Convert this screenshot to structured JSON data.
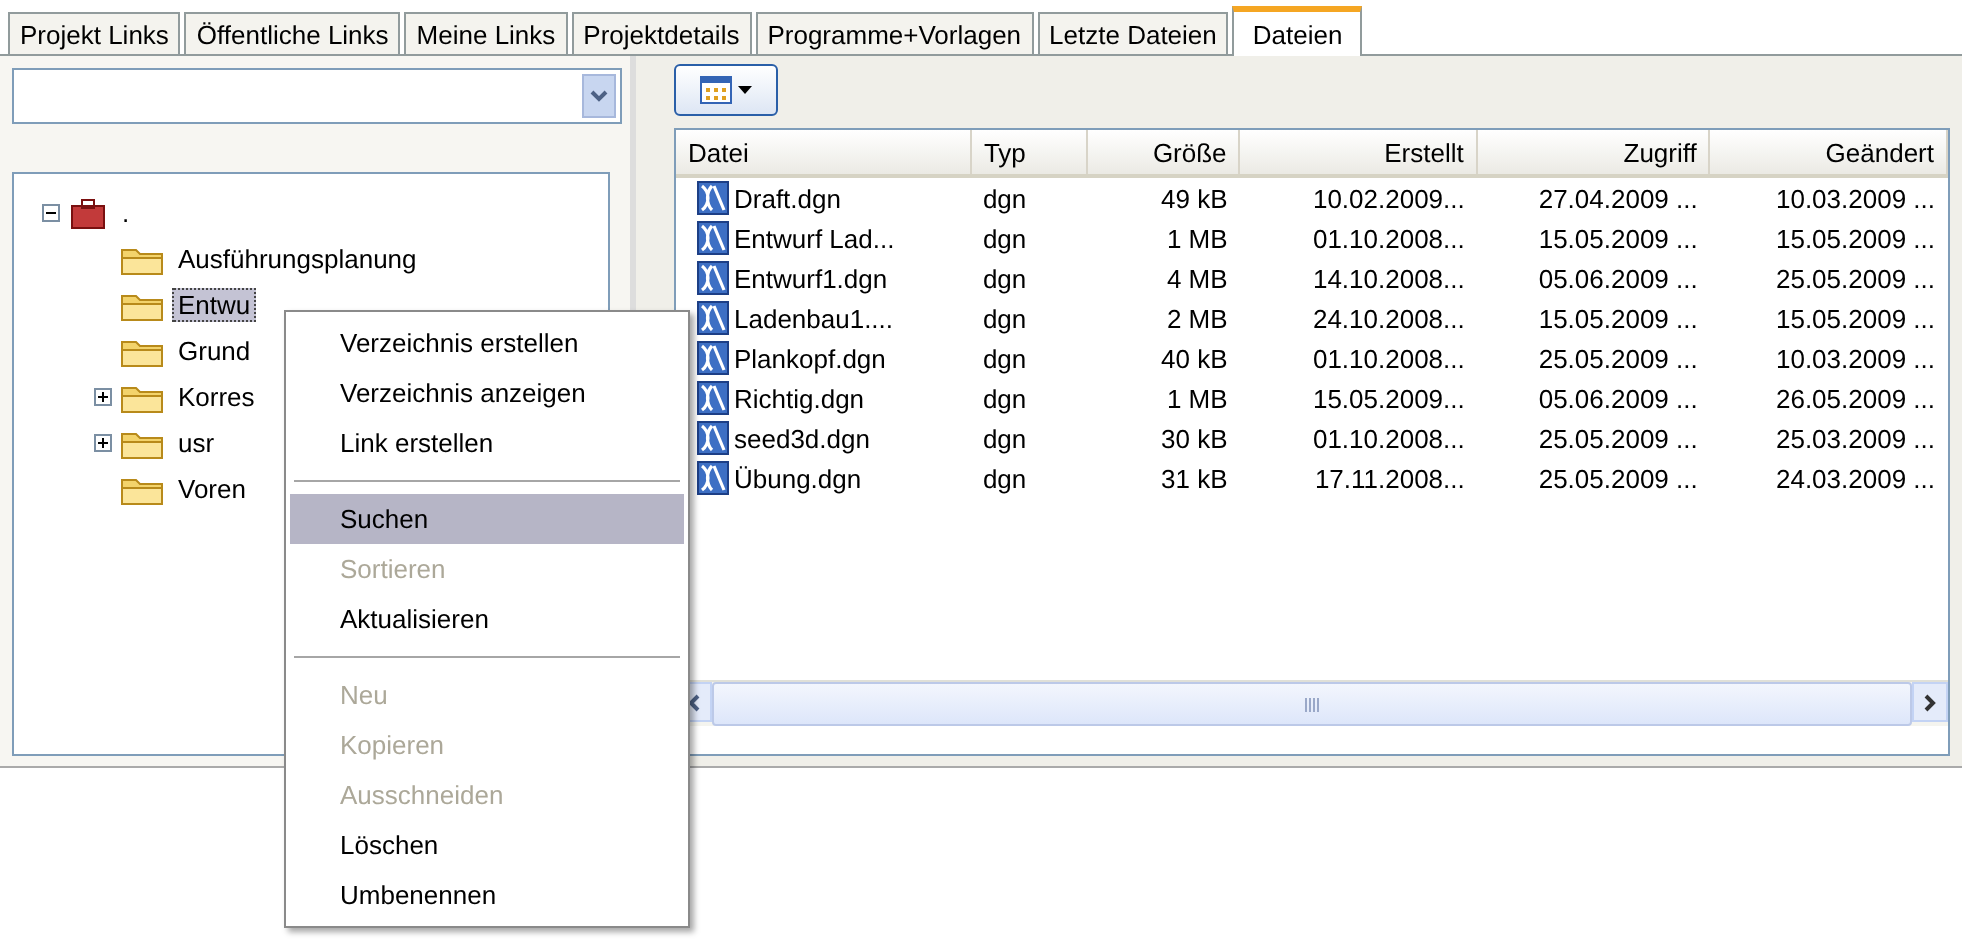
{
  "tabs": [
    {
      "label": "Projekt Links",
      "selected": false
    },
    {
      "label": "Öffentliche Links",
      "selected": false
    },
    {
      "label": "Meine Links",
      "selected": false
    },
    {
      "label": "Projektdetails",
      "selected": false
    },
    {
      "label": "Programme+Vorlagen",
      "selected": false
    },
    {
      "label": "Letzte Dateien",
      "selected": false
    },
    {
      "label": "Dateien",
      "selected": true
    }
  ],
  "tree": {
    "root": {
      "label": ".",
      "expanded": true
    },
    "children": [
      {
        "label": "Ausführungsplanung",
        "kind": "leaf",
        "selected": false
      },
      {
        "label": "Entwu",
        "kind": "leaf",
        "selected": true
      },
      {
        "label": "Grund",
        "kind": "leaf",
        "selected": false
      },
      {
        "label": "Korres",
        "kind": "collapsed",
        "selected": false
      },
      {
        "label": "usr",
        "kind": "collapsed",
        "selected": false
      },
      {
        "label": "Voren",
        "kind": "leaf",
        "selected": false
      }
    ]
  },
  "files": {
    "columns": [
      "Datei",
      "Typ",
      "Größe",
      "Erstellt",
      "Zugriff",
      "Geändert"
    ],
    "rows": [
      [
        "Draft.dgn",
        "dgn",
        "49 kB",
        "10.02.2009...",
        "27.04.2009 ...",
        "10.03.2009 ..."
      ],
      [
        "Entwurf Lad...",
        "dgn",
        "1 MB",
        "01.10.2008...",
        "15.05.2009 ...",
        "15.05.2009 ..."
      ],
      [
        "Entwurf1.dgn",
        "dgn",
        "4 MB",
        "14.10.2008...",
        "05.06.2009 ...",
        "25.05.2009 ..."
      ],
      [
        "Ladenbau1....",
        "dgn",
        "2 MB",
        "24.10.2008...",
        "15.05.2009 ...",
        "15.05.2009 ..."
      ],
      [
        "Plankopf.dgn",
        "dgn",
        "40 kB",
        "01.10.2008...",
        "25.05.2009 ...",
        "10.03.2009 ..."
      ],
      [
        "Richtig.dgn",
        "dgn",
        "1 MB",
        "15.05.2009...",
        "05.06.2009 ...",
        "26.05.2009 ..."
      ],
      [
        "seed3d.dgn",
        "dgn",
        "30 kB",
        "01.10.2008...",
        "25.05.2009 ...",
        "25.03.2009 ..."
      ],
      [
        "Übung.dgn",
        "dgn",
        "31 kB",
        "17.11.2008...",
        "25.05.2009 ...",
        "24.03.2009 ..."
      ]
    ]
  },
  "context_menu": [
    {
      "kind": "item",
      "label": "Verzeichnis erstellen",
      "disabled": false,
      "selected": false
    },
    {
      "kind": "item",
      "label": "Verzeichnis anzeigen",
      "disabled": false,
      "selected": false
    },
    {
      "kind": "item",
      "label": "Link erstellen",
      "disabled": false,
      "selected": false
    },
    {
      "kind": "separator"
    },
    {
      "kind": "item",
      "label": "Suchen",
      "disabled": false,
      "selected": true
    },
    {
      "kind": "item",
      "label": "Sortieren",
      "disabled": true,
      "selected": false
    },
    {
      "kind": "item",
      "label": "Aktualisieren",
      "disabled": false,
      "selected": false
    },
    {
      "kind": "separator"
    },
    {
      "kind": "item",
      "label": "Neu",
      "disabled": true,
      "selected": false
    },
    {
      "kind": "item",
      "label": "Kopieren",
      "disabled": true,
      "selected": false
    },
    {
      "kind": "item",
      "label": "Ausschneiden",
      "disabled": true,
      "selected": false
    },
    {
      "kind": "item",
      "label": "Löschen",
      "disabled": false,
      "selected": false
    },
    {
      "kind": "item",
      "label": "Umbenennen",
      "disabled": false,
      "selected": false
    }
  ]
}
